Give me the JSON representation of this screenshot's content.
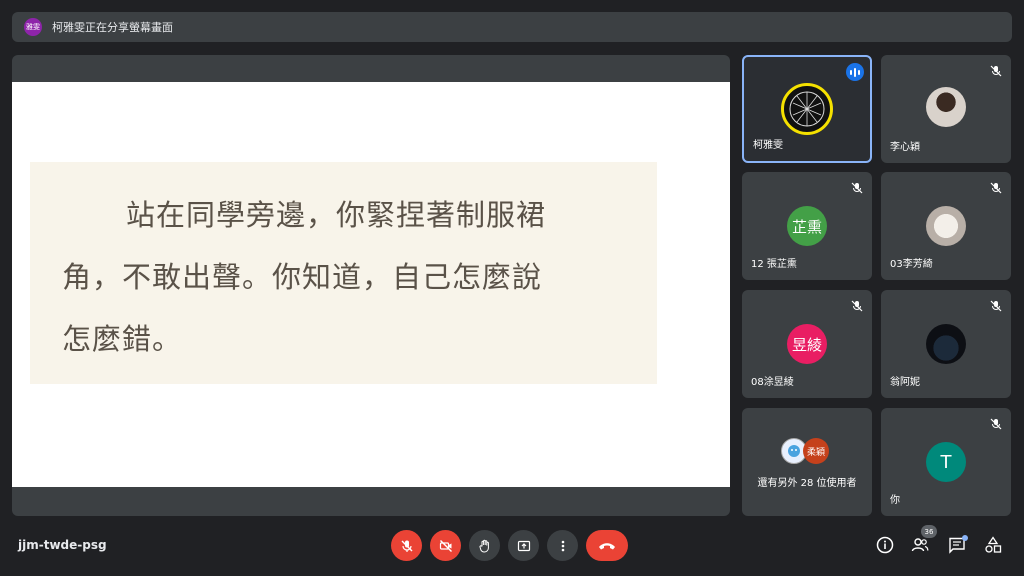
{
  "banner": {
    "badge_text": "雅雯",
    "text": "柯雅雯正在分享螢幕畫面"
  },
  "shared_screen": {
    "lines": [
      "站在同學旁邊，你緊捏著制服裙",
      "角，不敢出聲。你知道，自己怎麼說",
      "怎麼錯。"
    ]
  },
  "participants": [
    {
      "name": "柯雅雯",
      "speaking": true,
      "avatar_icon": "logo-icon"
    },
    {
      "name": "李心穎",
      "muted": true,
      "avatar_icon": "photo-icon"
    },
    {
      "name": "12 張芷熏",
      "muted": true,
      "avatar_text": "芷熏",
      "avatar_color": "#43a047"
    },
    {
      "name": "03李芳綺",
      "muted": true,
      "avatar_icon": "photo-icon"
    },
    {
      "name": "08涂昱綾",
      "muted": true,
      "avatar_text": "昱綾",
      "avatar_color": "#e91e63"
    },
    {
      "name": "翁阿妮",
      "muted": true,
      "avatar_icon": "photo-icon"
    },
    {
      "name": "還有另外 28 位使用者",
      "avatar_text": "柔穎"
    },
    {
      "name": "你",
      "muted": true,
      "avatar_text": "T",
      "avatar_color": "#00897b"
    }
  ],
  "bottom_bar": {
    "meeting_code": "jjm-twde-psg",
    "people_count": "36"
  },
  "colors": {
    "danger": "#ea4335",
    "accent": "#8ab4f8",
    "surface": "#3c4043"
  }
}
